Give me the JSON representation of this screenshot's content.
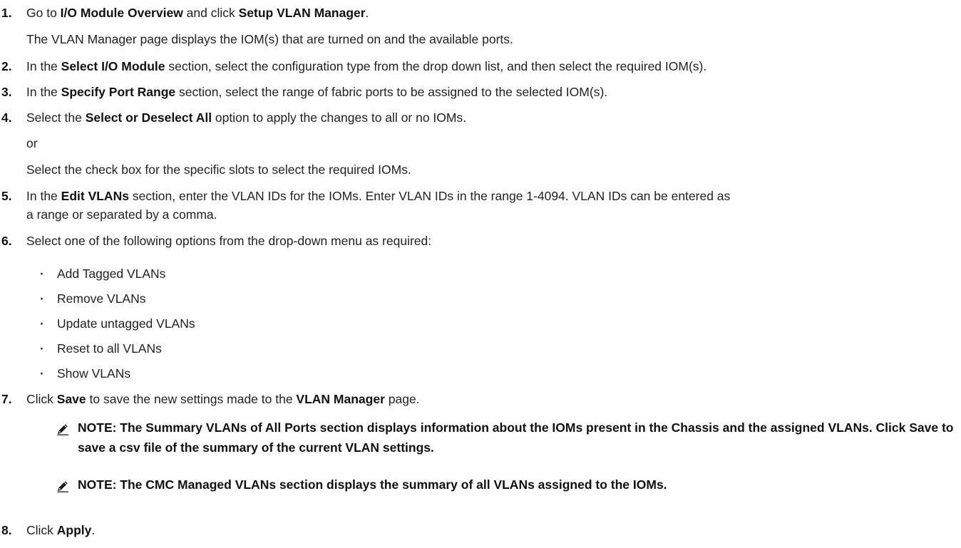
{
  "steps": [
    {
      "num": "1.",
      "parts": [
        {
          "t": "Go to "
        },
        {
          "b": "I/O Module Overview"
        },
        {
          "t": " and click "
        },
        {
          "b": "Setup VLAN Manager"
        },
        {
          "t": "."
        }
      ]
    },
    {
      "sub": "The VLAN Manager page displays the IOM(s) that are turned on and the available ports."
    },
    {
      "num": "2.",
      "parts": [
        {
          "t": "In the "
        },
        {
          "b": "Select I/O Module"
        },
        {
          "t": " section, select the configuration type from the drop down list, and then select the required IOM(s)."
        }
      ]
    },
    {
      "num": "3.",
      "parts": [
        {
          "t": "In the "
        },
        {
          "b": "Specify Port Range"
        },
        {
          "t": " section, select the range of fabric ports to be assigned to the selected IOM(s)."
        }
      ]
    },
    {
      "num": "4.",
      "parts": [
        {
          "t": "Select the "
        },
        {
          "b": "Select or Deselect All"
        },
        {
          "t": " option to apply the changes to all or no IOMs."
        }
      ]
    },
    {
      "sub": "or"
    },
    {
      "sub": "Select the check box for the specific slots to select the required IOMs."
    },
    {
      "num": "5.",
      "parts": [
        {
          "t": "In the "
        },
        {
          "b": "Edit VLANs"
        },
        {
          "t": " section, enter the VLAN IDs for the IOMs. Enter VLAN IDs in the range 1-4094. VLAN IDs can be entered as"
        }
      ]
    },
    {
      "sub": "a range or separated by a comma."
    },
    {
      "num": "6.",
      "parts": [
        {
          "t": "Select one of the following options from the drop-down menu as required:"
        }
      ]
    }
  ],
  "options": [
    "Add Tagged VLANs",
    "Remove VLANs",
    "Update untagged VLANs",
    "Reset to all VLANs",
    "Show VLANs"
  ],
  "step7": {
    "num": "7.",
    "parts": [
      {
        "t": "Click "
      },
      {
        "b": "Save"
      },
      {
        "t": " to save the new settings made to the "
      },
      {
        "b": "VLAN Manager"
      },
      {
        "t": " page."
      }
    ]
  },
  "notes": [
    "NOTE: The Summary VLANs of All Ports section displays information about the IOMs present in the Chassis and the assigned VLANs. Click Save to save a csv file of the summary of the current VLAN settings.",
    "NOTE: The CMC Managed VLANs section displays the summary of all VLANs assigned to the IOMs."
  ],
  "step8": {
    "num": "8.",
    "parts": [
      {
        "t": "Click "
      },
      {
        "b": "Apply"
      },
      {
        "t": "."
      }
    ]
  },
  "bullet_glyph": "·"
}
